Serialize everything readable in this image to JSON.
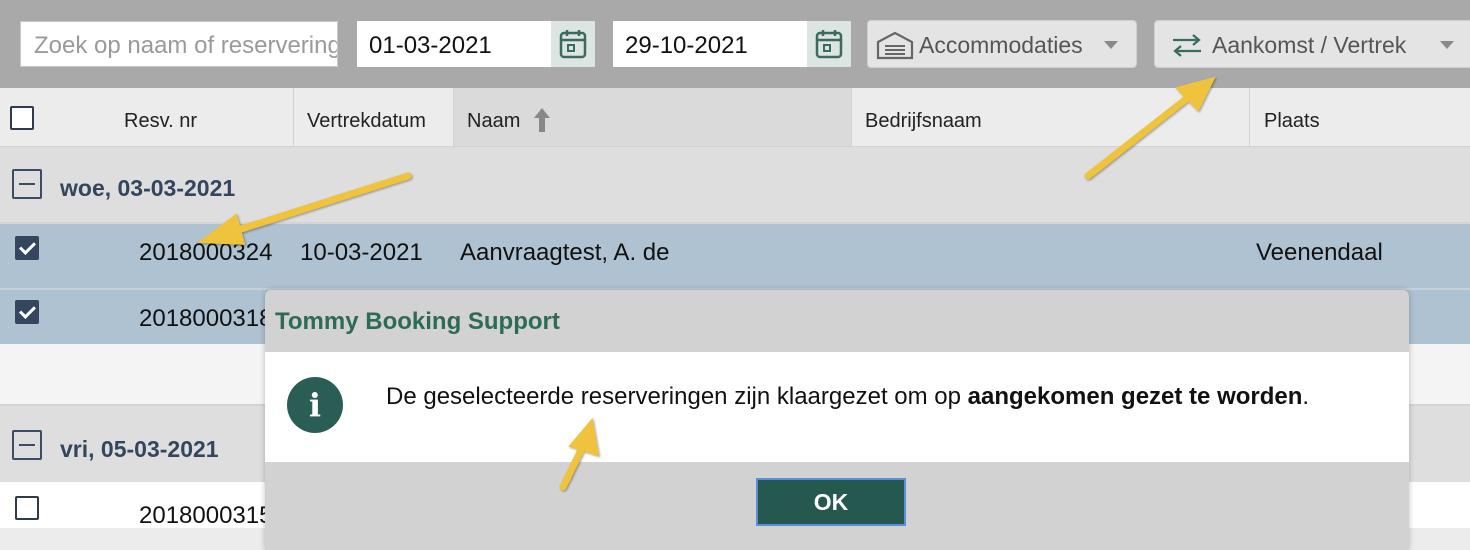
{
  "toolbar": {
    "search_placeholder": "Zoek op naam of reserveringsnummer",
    "date_from": "01-03-2021",
    "date_to": "29-10-2021",
    "accommodations_label": "Accommodaties",
    "arrival_departure_label": "Aankomst / Vertrek"
  },
  "table": {
    "columns": [
      "Resv. nr",
      "Vertrekdatum",
      "Naam",
      "Bedrijfsnaam",
      "Plaats"
    ],
    "sorted_column": "Naam",
    "groups": [
      {
        "title": "woe, 03-03-2021",
        "rows": [
          {
            "checked": true,
            "resv_nr": "2018000324",
            "vertrekdatum": "10-03-2021",
            "naam": "Aanvraagtest, A. de",
            "bedrijfsnaam": "",
            "plaats": "Veenendaal"
          },
          {
            "checked": true,
            "resv_nr": "2018000318",
            "vertrekdatum": "",
            "naam": "",
            "bedrijfsnaam": "",
            "plaats": ""
          }
        ]
      },
      {
        "title": "vri, 05-03-2021",
        "rows": [
          {
            "checked": false,
            "resv_nr": "2018000315",
            "vertrekdatum": "",
            "naam": "",
            "bedrijfsnaam": "",
            "plaats": ""
          }
        ]
      }
    ]
  },
  "dialog": {
    "title": "Tommy Booking Support",
    "message_prefix": "De geselecteerde reserveringen zijn klaargezet om op ",
    "message_bold": "aangekomen gezet te worden",
    "message_suffix": ".",
    "ok_label": "OK"
  },
  "colors": {
    "toolbar_bg": "#a9a9a9",
    "selected_row": "#afc2d1",
    "group_title": "#34465e",
    "dialog_title": "#2d6b57",
    "ok_button": "#25594f",
    "annotation_arrow": "#f0c33c"
  }
}
